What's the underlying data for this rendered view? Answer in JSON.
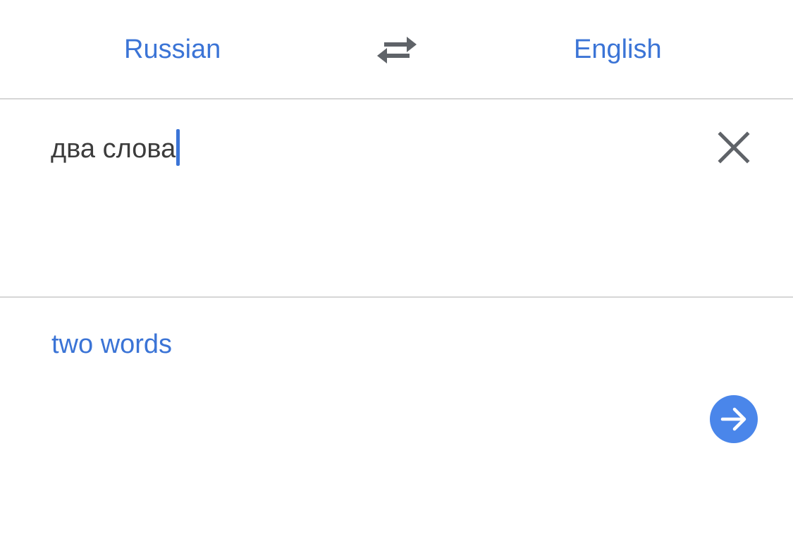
{
  "languages": {
    "source": "Russian",
    "target": "English"
  },
  "icons": {
    "swap": "swap-arrows-icon",
    "clear": "close-icon",
    "submit": "arrow-right-icon"
  },
  "input": {
    "text": "два слова"
  },
  "output": {
    "text": "two words"
  },
  "colors": {
    "accent": "#3b74d6",
    "icon_gray": "#5f6368",
    "button_blue": "#4a86ea",
    "divider": "#d6d6d6"
  }
}
